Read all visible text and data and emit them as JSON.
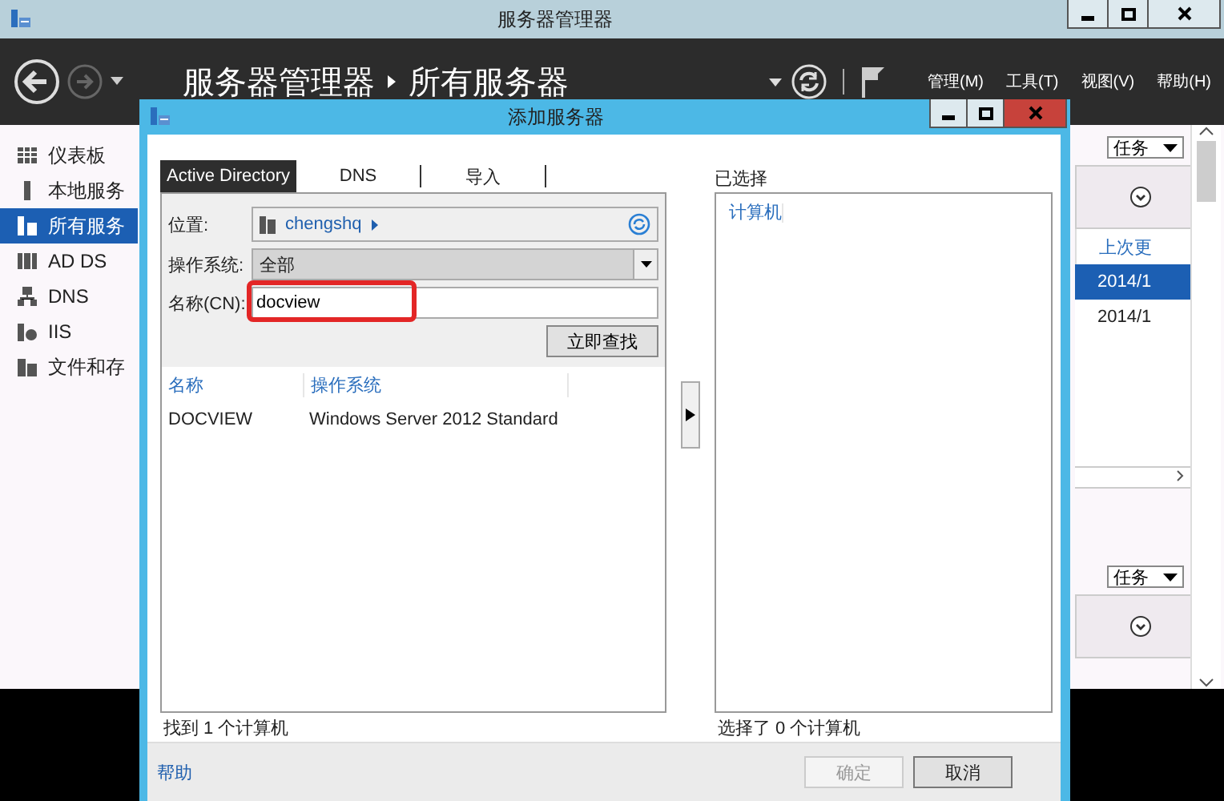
{
  "window": {
    "title": "服务器管理器"
  },
  "header": {
    "breadcrumb": [
      "服务器管理器",
      "所有服务器"
    ],
    "menus": [
      "管理(M)",
      "工具(T)",
      "视图(V)",
      "帮助(H)"
    ]
  },
  "sidebar": {
    "items": [
      {
        "label": "仪表板",
        "selected": false
      },
      {
        "label": "本地服务",
        "selected": false
      },
      {
        "label": "所有服务",
        "selected": true
      },
      {
        "label": "AD DS",
        "selected": false
      },
      {
        "label": "DNS",
        "selected": false
      },
      {
        "label": "IIS",
        "selected": false
      },
      {
        "label": "文件和存",
        "selected": false
      }
    ]
  },
  "content": {
    "tasks": [
      "任务",
      "任务"
    ],
    "column_header": "上次更",
    "rows": [
      {
        "value": "2014/1",
        "selected": true
      },
      {
        "value": "2014/1",
        "selected": false
      }
    ]
  },
  "dialog": {
    "title": "添加服务器",
    "tabs": [
      {
        "label": "Active Directory",
        "selected": true
      },
      {
        "label": "DNS",
        "selected": false
      },
      {
        "label": "导入",
        "selected": false
      }
    ],
    "location_label": "位置:",
    "location": "chengshq",
    "os_label": "操作系统:",
    "os_value": "全部",
    "name_label": "名称(CN):",
    "name_value": "docview",
    "find_button": "立即查找",
    "columns": [
      "名称",
      "操作系统"
    ],
    "results": [
      {
        "name": "DOCVIEW",
        "os": "Windows Server 2012 Standard"
      }
    ],
    "found_status": "找到 1 个计算机",
    "selected_label": "已选择",
    "selected_column": "计算机",
    "selected_status": "选择了 0 个计算机",
    "help_link": "帮助",
    "buttons": [
      {
        "label": "确定",
        "disabled": true
      },
      {
        "label": "取消",
        "disabled": false
      }
    ]
  }
}
